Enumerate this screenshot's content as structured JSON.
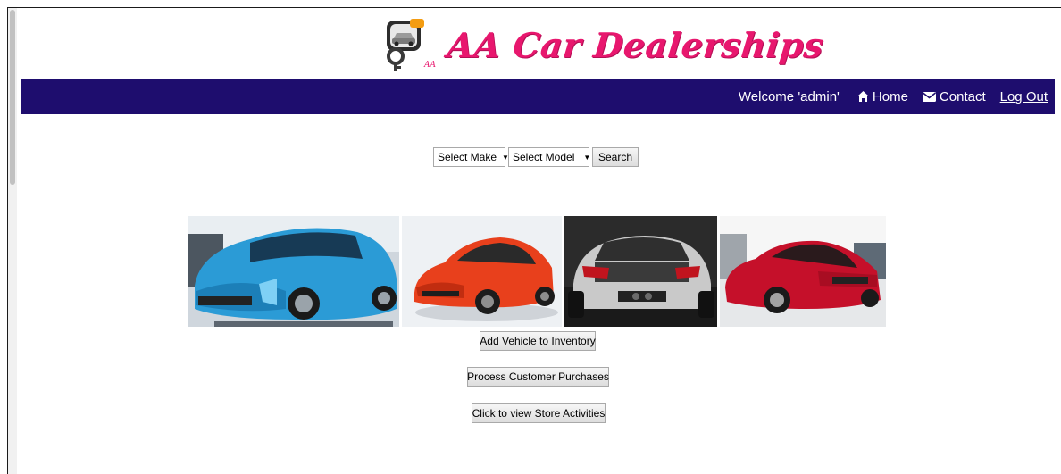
{
  "app": {
    "title": "AA Car Dealerships",
    "brand_color": "#e8176e",
    "nav_color": "#1e0d6e"
  },
  "navbar": {
    "welcome": "Welcome 'admin'",
    "home_label": "Home",
    "home_icon": "home-icon",
    "contact_label": "Contact",
    "contact_icon": "envelope-icon",
    "logout_label": "Log Out"
  },
  "search": {
    "make_selected": "Select Make",
    "model_selected": "Select Model",
    "search_label": "Search"
  },
  "gallery": {
    "images": [
      {
        "name": "blue-concept-car",
        "color": "#2b9bd6"
      },
      {
        "name": "orange-hatchback",
        "color": "#e8401c"
      },
      {
        "name": "silver-hatchback",
        "color": "#c9c9c9"
      },
      {
        "name": "red-sedan",
        "color": "#c5102a"
      }
    ]
  },
  "actions": {
    "add_vehicle": "Add Vehicle to Inventory",
    "process_purchases": "Process Customer Purchases",
    "view_activities": "Click to view Store Activities"
  }
}
